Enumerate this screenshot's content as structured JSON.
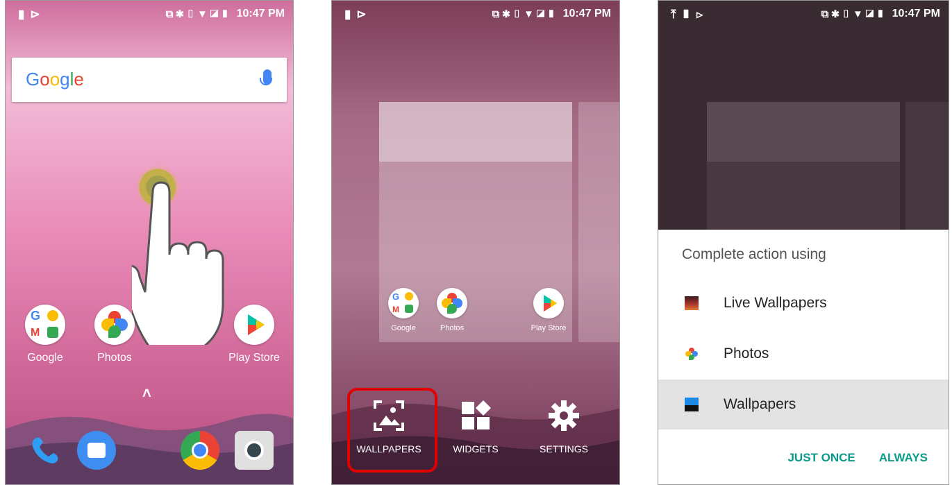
{
  "status": {
    "time": "10:47 PM"
  },
  "screen1": {
    "search_logo": "Google",
    "apps": [
      "Google",
      "Photos",
      "Play Store"
    ]
  },
  "screen2": {
    "apps": [
      "Google",
      "Photos",
      "Play Store"
    ],
    "menu": [
      "WALLPAPERS",
      "WIDGETS",
      "SETTINGS"
    ]
  },
  "screen3": {
    "title": "Complete action using",
    "options": [
      "Live Wallpapers",
      "Photos",
      "Wallpapers"
    ],
    "selected_option": "Wallpapers",
    "buttons": {
      "just_once": "JUST ONCE",
      "always": "ALWAYS"
    }
  },
  "colors": {
    "accent": "#0a9a8a",
    "highlight_box": "#e00000"
  },
  "icons": [
    "cast-icon",
    "bluetooth-icon",
    "vibrate-icon",
    "wifi-icon",
    "signal-icon",
    "battery-icon",
    "mic-icon",
    "phone-icon",
    "messages-icon",
    "chrome-icon",
    "camera-icon",
    "wallpaper-icon",
    "widgets-icon",
    "settings-gear-icon",
    "upload-icon"
  ]
}
